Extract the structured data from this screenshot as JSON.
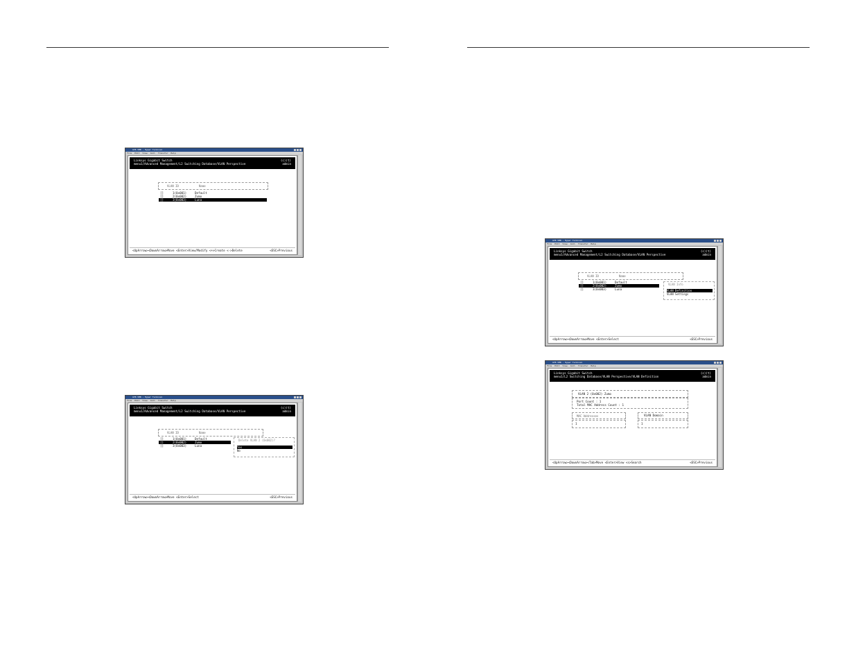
{
  "window": {
    "title": "GTB VMB - Hyper Terminal",
    "menu": [
      "File",
      "Edit",
      "View",
      "Call",
      "Transfer",
      "Help"
    ]
  },
  "header": {
    "brand": "Linksys Gigabit Switch",
    "user_level": "(c)(t)",
    "user": "admin"
  },
  "table": {
    "col_vlan": "VLAN ID",
    "col_name": "Name",
    "rows": [
      {
        "mark": "[]",
        "id": "1(0x001)",
        "name": "Default"
      },
      {
        "mark": "[]",
        "id": "2(0x002)",
        "name": "Zumo"
      },
      {
        "mark": "[]",
        "id": "3(0x003)",
        "name": "Luna"
      }
    ]
  },
  "shot1": {
    "path": "menu1/Advanced Management/L2 Switching Database/VLAN Perspective",
    "status_left": "<UpArrow><DownArrow>Move  <Enter>View/Modify  <+>Create  <->Delete",
    "status_right": "<ESC>Previous"
  },
  "shot2": {
    "path": "menu1/Advanced Management/L2 Switching Database/VLAN Perspective",
    "popup_title": "Delete VLAN 2 (0x002)?",
    "options": [
      "Yes",
      "No"
    ],
    "status_left": "<UpArrow><DownArrow>Move  <Enter>Select",
    "status_right": "<ESC>Previous"
  },
  "shot3": {
    "path": "menu1/Advanced Management/L2 Switching Database/VLAN Perspective",
    "popup_title": "VLAN Info",
    "options": [
      "VLAN Definition",
      "VLAN Settings"
    ],
    "status_left": "<UpArrow><DownArrow>Move  <Enter>Select",
    "status_right": "<ESC>Previous"
  },
  "shot4": {
    "path": "menu1/L2 Switching Database/VLAN Perspective/VLAN Definition",
    "vlan_title": "VLAN 2 (0x002)  Zumo",
    "port_count": "Port Count : 1",
    "mac_count": "Total MAC Address Count : 1",
    "mac_header": "MAC Addresses",
    "domain_header": "VLAN Domain",
    "mac_value": "1",
    "domain_value": "1",
    "status_left": "<UpArrow><DownArrow><Tab>Move  <Enter>View  <s>Search",
    "status_right": "<ESC>Previous"
  }
}
